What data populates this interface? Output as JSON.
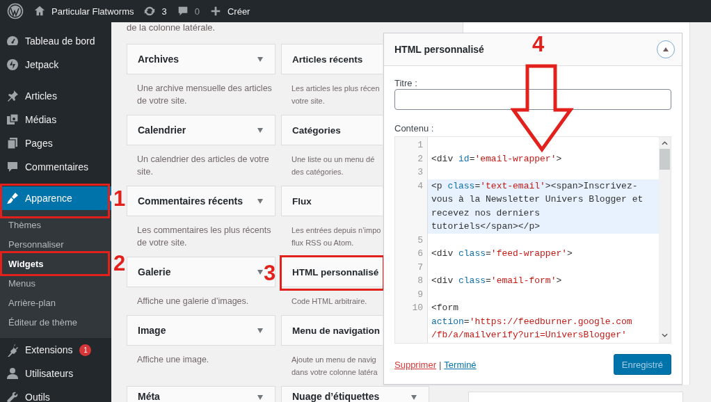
{
  "admin_bar": {
    "site": "Particular Flatworms",
    "updates": "3",
    "comments": "0",
    "new": "Créer"
  },
  "sidebar": {
    "groups": [
      {
        "items": [
          {
            "label": "Tableau de bord",
            "selected": false
          },
          {
            "label": "Jetpack",
            "selected": false
          }
        ]
      },
      {
        "items": [
          {
            "label": "Articles",
            "selected": false
          },
          {
            "label": "Médias",
            "selected": false
          },
          {
            "label": "Pages",
            "selected": false
          },
          {
            "label": "Commentaires",
            "selected": false
          }
        ]
      },
      {
        "items": [
          {
            "label": "Apparence",
            "selected": true,
            "callout": "1",
            "submenu": [
              {
                "label": "Thèmes",
                "selected": false
              },
              {
                "label": "Personnaliser",
                "selected": false
              },
              {
                "label": "Widgets",
                "selected": true,
                "callout": "2"
              },
              {
                "label": "Menus",
                "selected": false
              },
              {
                "label": "Arrière-plan",
                "selected": false
              },
              {
                "label": "Éditeur de thème",
                "selected": false
              }
            ]
          },
          {
            "label": "Extensions",
            "selected": false,
            "badge": "1"
          },
          {
            "label": "Utilisateurs",
            "selected": false
          },
          {
            "label": "Outils",
            "selected": false
          }
        ]
      }
    ]
  },
  "content": {
    "intro": "de la colonne latérale.",
    "widgets": [
      {
        "title": "Archives",
        "description": "Une archive mensuelle des articles\nde votre site.",
        "caret": true
      },
      {
        "title": "Articles récents",
        "description": "Les articles les plus récen\nvotre site.",
        "caret": false
      },
      {
        "title": "Calendrier",
        "description": "Un calendrier des articles de votre\nsite.",
        "caret": true
      },
      {
        "title": "Catégories",
        "description": "Une liste ou un menu dé\ndes catégories.",
        "caret": false
      },
      {
        "title": "Commentaires récents",
        "description": "Les commentaires les plus récents\nde votre site.",
        "caret": true
      },
      {
        "title": "Flux",
        "description": "Les entrées depuis n’impo\nflux RSS ou Atom.",
        "caret": false
      },
      {
        "title": "Galerie",
        "description": "Affiche une galerie d’images.",
        "caret": true
      },
      {
        "title": "HTML personnalisé",
        "description": "Code HTML arbitraire.",
        "caret": false,
        "callout": "3"
      },
      {
        "title": "Image",
        "description": "Affiche une image.",
        "caret": true
      },
      {
        "title": "Menu de navigation",
        "description": "Ajoute un menu de navig\ndans votre colonne latéra",
        "caret": false
      },
      {
        "title": "Méta",
        "caret": true
      },
      {
        "title": "Nuage d’étiquettes",
        "caret": true
      }
    ]
  },
  "panel": {
    "title": "HTML personnalisé",
    "expanded": true,
    "callout": "4",
    "title_label": "Titre :",
    "content_label": "Contenu :",
    "code_lines": [
      {
        "number": "1",
        "active": false
      },
      {
        "number": "2",
        "active": false,
        "rows": [
          [
            {
              "kind": "tag",
              "text": "<div "
            },
            {
              "kind": "attr",
              "text": "id"
            },
            {
              "kind": "tag",
              "text": "="
            },
            {
              "kind": "string",
              "text": "'email-wrapper'"
            },
            {
              "kind": "tag",
              "text": ">"
            }
          ]
        ]
      },
      {
        "number": "3",
        "active": false
      },
      {
        "number": "4",
        "active": true,
        "rows": [
          [
            {
              "kind": "tag",
              "text": "<p "
            },
            {
              "kind": "attr",
              "text": "class"
            },
            {
              "kind": "tag",
              "text": "="
            },
            {
              "kind": "string",
              "text": "'text-email'"
            },
            {
              "kind": "tag",
              "text": "><span>Inscrivez-"
            }
          ],
          [
            {
              "kind": "tag",
              "text": "vous à la Newsletter Univers Blogger et"
            }
          ],
          [
            {
              "kind": "tag",
              "text": "recevez nos derniers"
            }
          ],
          [
            {
              "kind": "tag",
              "text": "tutoriels</span></p>"
            }
          ]
        ]
      },
      {
        "number": "5",
        "active": false
      },
      {
        "number": "6",
        "active": false,
        "rows": [
          [
            {
              "kind": "tag",
              "text": "<div "
            },
            {
              "kind": "attr",
              "text": "class"
            },
            {
              "kind": "tag",
              "text": "="
            },
            {
              "kind": "string",
              "text": "'feed-wrapper'"
            },
            {
              "kind": "tag",
              "text": ">"
            }
          ]
        ]
      },
      {
        "number": "7",
        "active": false
      },
      {
        "number": "8",
        "active": false,
        "rows": [
          [
            {
              "kind": "tag",
              "text": "<div "
            },
            {
              "kind": "attr",
              "text": "class"
            },
            {
              "kind": "tag",
              "text": "="
            },
            {
              "kind": "string",
              "text": "'email-form'"
            },
            {
              "kind": "tag",
              "text": ">"
            }
          ]
        ]
      },
      {
        "number": "9",
        "active": false
      },
      {
        "number": "10",
        "active": false,
        "rows": [
          [
            {
              "kind": "tag",
              "text": "<form"
            }
          ],
          [
            {
              "kind": "attr",
              "text": "action"
            },
            {
              "kind": "tag",
              "text": "="
            },
            {
              "kind": "string",
              "text": "'https://feedburner.google.com"
            }
          ],
          [
            {
              "kind": "string",
              "text": "/fb/a/mailverify?uri=UniversBlogger'"
            }
          ]
        ]
      }
    ],
    "delete_link": "Supprimer",
    "separator": "|",
    "done_link": "Terminé",
    "save_button": {
      "label": "Enregistré",
      "disabled": true
    }
  }
}
